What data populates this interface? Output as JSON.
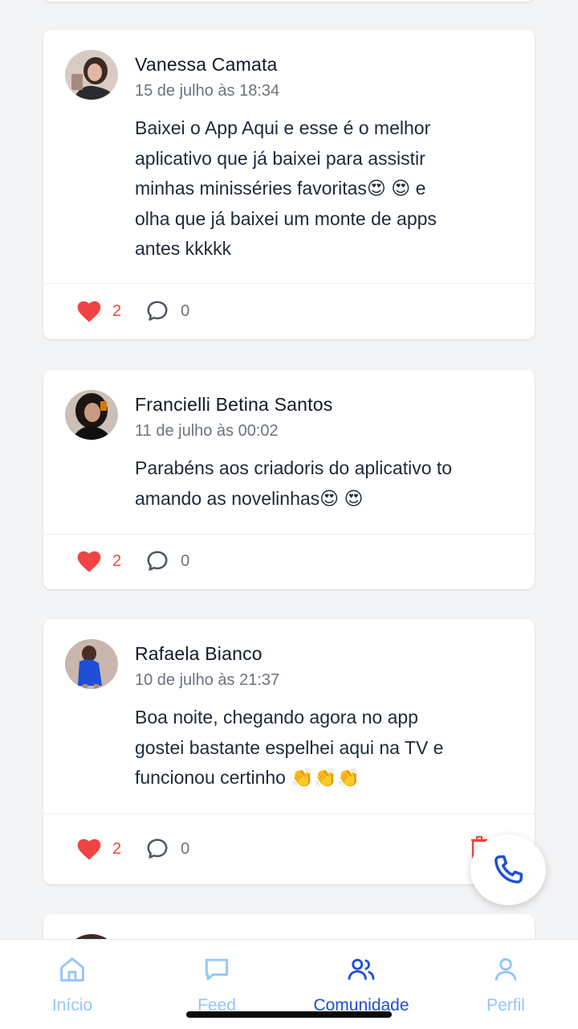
{
  "posts": [
    {
      "author": "Vanessa Camata",
      "date": "15 de julho às 18:34",
      "text": "Baixei o App Aqui e esse é o melhor\naplicativo que já baixei para assistir\nminhas minisséries favoritas😍 😍  e\nolha que já baixei um monte de apps\nantes kkkkk",
      "likes": "2",
      "comments": "0"
    },
    {
      "author": "Francielli Betina Santos",
      "date": "11 de julho às 00:02",
      "text": "Parabéns aos criadoris do aplicativo to\namando as novelinhas😍 😍",
      "likes": "2",
      "comments": "0"
    },
    {
      "author": "Rafaela Bianco",
      "date": "10 de julho às 21:37",
      "text": "Boa noite, chegando agora no app\ngostei bastante espelhei aqui na TV e\nfuncionou certinho 👏👏👏",
      "likes": "2",
      "comments": "0"
    }
  ],
  "tabs": [
    {
      "label": "Início",
      "icon": "home-icon"
    },
    {
      "label": "Feed",
      "icon": "message-icon"
    },
    {
      "label": "Comunidade",
      "icon": "users-icon"
    },
    {
      "label": "Perfil",
      "icon": "user-icon"
    }
  ],
  "active_tab": "Comunidade",
  "colors": {
    "accent": "#1d4ed8",
    "inactive_tab": "#93c5fd",
    "like": "#ef4444",
    "background": "#f3f4f6"
  }
}
